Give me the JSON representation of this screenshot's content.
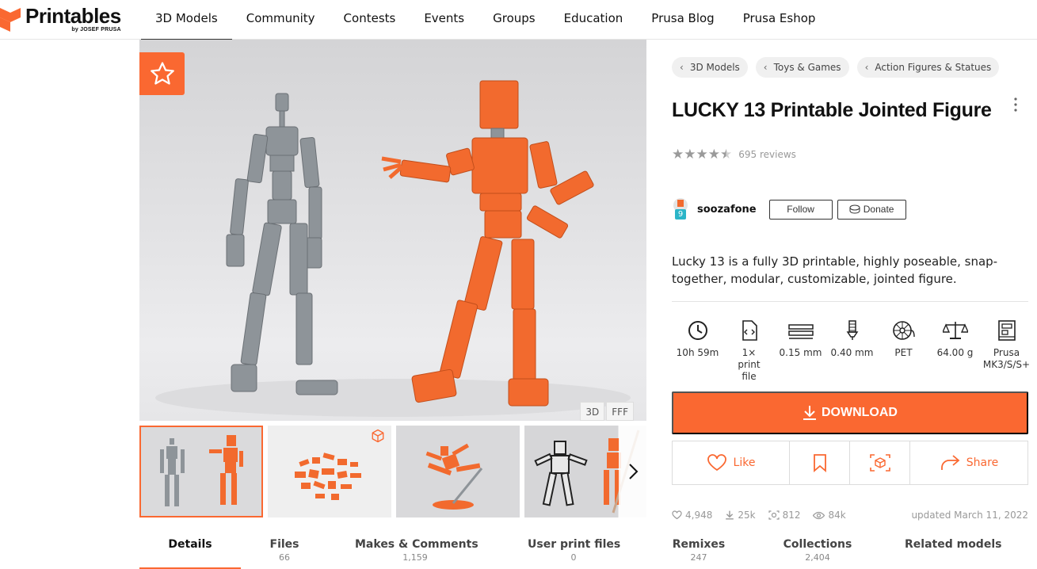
{
  "header": {
    "brand": "Printables",
    "brand_sub": "by JOSEF PRUSA",
    "nav": [
      {
        "label": "3D Models",
        "active": true
      },
      {
        "label": "Community"
      },
      {
        "label": "Contests"
      },
      {
        "label": "Events"
      },
      {
        "label": "Groups"
      },
      {
        "label": "Education"
      },
      {
        "label": "Prusa Blog"
      },
      {
        "label": "Prusa Eshop"
      }
    ]
  },
  "gallery": {
    "view_toggle": [
      "3D",
      "FFF"
    ],
    "thumbnail_count": 4
  },
  "breadcrumbs": [
    "3D Models",
    "Toys & Games",
    "Action Figures & Statues"
  ],
  "model": {
    "title": "LUCKY 13 Printable Jointed Figure",
    "rating": 4.5,
    "reviews": "695 reviews",
    "author": "soozafone",
    "author_badge": "9",
    "follow_label": "Follow",
    "donate_label": "Donate",
    "summary": "Lucky 13 is a fully 3D printable, highly poseable, snap-together, modular, customizable, jointed figure."
  },
  "params": [
    {
      "icon": "clock-icon",
      "value": "10h 59m"
    },
    {
      "icon": "file-icon",
      "value": "1× print file"
    },
    {
      "icon": "layer-height-icon",
      "value": "0.15 mm"
    },
    {
      "icon": "nozzle-icon",
      "value": "0.40 mm"
    },
    {
      "icon": "filament-icon",
      "value": "PET"
    },
    {
      "icon": "weight-icon",
      "value": "64.00 g"
    },
    {
      "icon": "printer-icon",
      "value": "Prusa MK3/S/S+"
    }
  ],
  "actions": {
    "download": "DOWNLOAD",
    "like": "Like",
    "share": "Share"
  },
  "stats": {
    "likes": "4,948",
    "downloads": "25k",
    "makes": "812",
    "views": "84k",
    "updated": "updated March 11, 2022"
  },
  "tabs": [
    {
      "label": "Details",
      "count": "",
      "active": true
    },
    {
      "label": "Files",
      "count": "66"
    },
    {
      "label": "Makes & Comments",
      "count": "1,159"
    },
    {
      "label": "User print files",
      "count": "0"
    },
    {
      "label": "Remixes",
      "count": "247"
    },
    {
      "label": "Collections",
      "count": "2,404"
    },
    {
      "label": "Related models",
      "count": ""
    }
  ],
  "colors": {
    "accent": "#fa6831",
    "text": "#111111",
    "muted": "#999999"
  }
}
